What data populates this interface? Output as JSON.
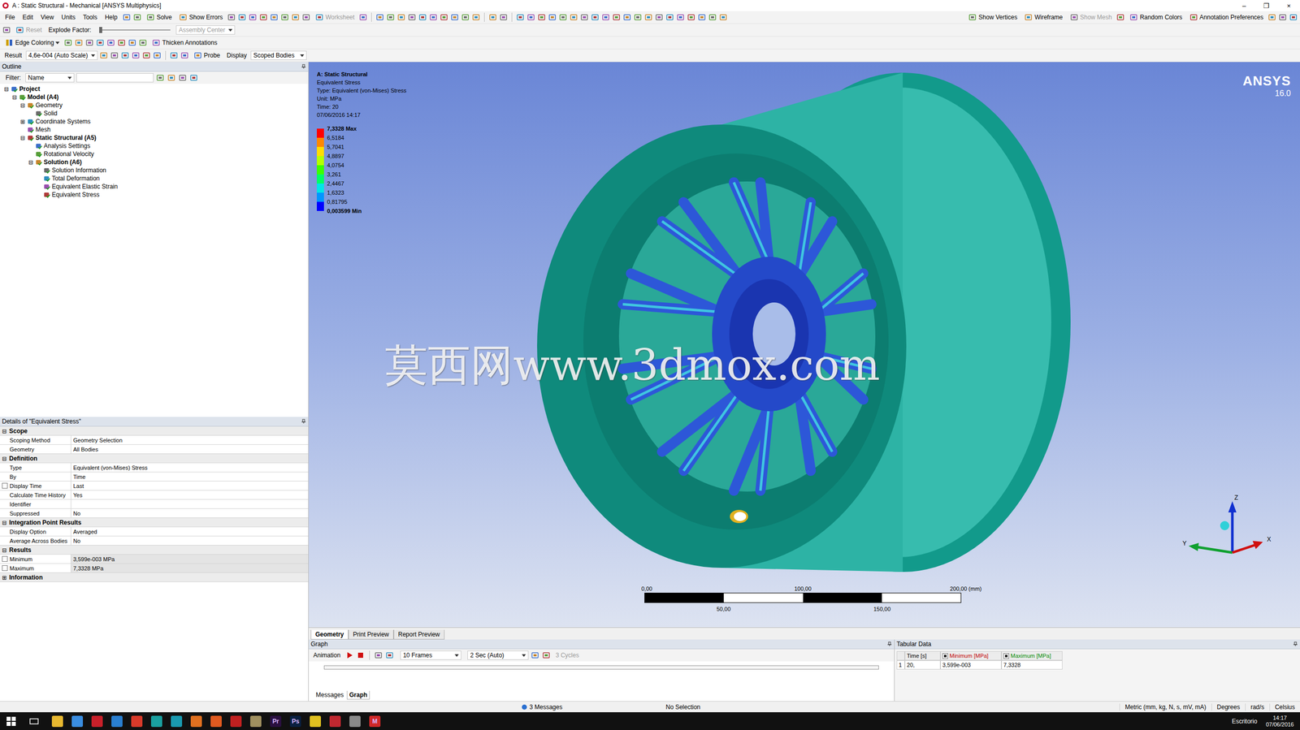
{
  "window": {
    "title": "A : Static Structural - Mechanical [ANSYS Multiphysics]",
    "controls": [
      "–",
      "❐",
      "×"
    ]
  },
  "menus": [
    "File",
    "Edit",
    "View",
    "Units",
    "Tools",
    "Help"
  ],
  "toolbar_main": [
    {
      "label": "Solve",
      "disabled": false
    },
    {
      "label": "Show Errors",
      "disabled": false
    },
    {
      "label": "Worksheet",
      "disabled": true
    }
  ],
  "toolbar_view": [
    {
      "label": "Show Vertices",
      "disabled": false
    },
    {
      "label": "Wireframe",
      "disabled": false
    },
    {
      "label": "Show Mesh",
      "disabled": true
    },
    {
      "label": "Random Colors",
      "disabled": false
    },
    {
      "label": "Annotation Preferences",
      "disabled": false
    }
  ],
  "explode_bar": {
    "reset": {
      "label": "Reset",
      "disabled": true
    },
    "factor_label": "Explode Factor:",
    "level": 0,
    "assembly": {
      "label": "Assembly Center",
      "disabled": true
    }
  },
  "edge_bar": {
    "edge_coloring": "Edge Coloring",
    "thicken": "Thicken Annotations"
  },
  "result_bar": {
    "result_label": "Result",
    "scale": "4,6e-004 (Auto Scale)",
    "probe": "Probe",
    "display_label": "Display",
    "display": "Scoped Bodies"
  },
  "outline": {
    "title": "Outline",
    "filter_label": "Filter:",
    "filter_value": "Name",
    "filter_text": "",
    "tree": [
      {
        "label": "Project",
        "depth": 0,
        "expander": "⊟",
        "bold": true
      },
      {
        "label": "Model (A4)",
        "depth": 1,
        "expander": "⊟",
        "bold": true
      },
      {
        "label": "Geometry",
        "depth": 2,
        "expander": "⊟",
        "bold": false
      },
      {
        "label": "Solid",
        "depth": 3,
        "expander": "",
        "bold": false
      },
      {
        "label": "Coordinate Systems",
        "depth": 2,
        "expander": "⊞",
        "bold": false
      },
      {
        "label": "Mesh",
        "depth": 2,
        "expander": "",
        "bold": false
      },
      {
        "label": "Static Structural (A5)",
        "depth": 2,
        "expander": "⊟",
        "bold": true
      },
      {
        "label": "Analysis Settings",
        "depth": 3,
        "expander": "",
        "bold": false
      },
      {
        "label": "Rotational Velocity",
        "depth": 3,
        "expander": "",
        "bold": false
      },
      {
        "label": "Solution (A6)",
        "depth": 3,
        "expander": "⊟",
        "bold": true
      },
      {
        "label": "Solution Information",
        "depth": 4,
        "expander": "",
        "bold": false
      },
      {
        "label": "Total Deformation",
        "depth": 4,
        "expander": "",
        "bold": false
      },
      {
        "label": "Equivalent Elastic Strain",
        "depth": 4,
        "expander": "",
        "bold": false
      },
      {
        "label": "Equivalent Stress",
        "depth": 4,
        "expander": "",
        "bold": false
      }
    ]
  },
  "details": {
    "title": "Details of \"Equivalent Stress\"",
    "sections": [
      {
        "label": "Scope",
        "expander": "⊟",
        "rows": [
          {
            "label": "Scoping Method",
            "value": "Geometry Selection",
            "checkbox": false,
            "checked": false,
            "readonly": false
          },
          {
            "label": "Geometry",
            "value": "All Bodies",
            "checkbox": false,
            "checked": false,
            "readonly": false
          }
        ]
      },
      {
        "label": "Definition",
        "expander": "⊟",
        "rows": [
          {
            "label": "Type",
            "value": "Equivalent (von-Mises) Stress",
            "checkbox": false,
            "checked": false,
            "readonly": false
          },
          {
            "label": "By",
            "value": "Time",
            "checkbox": false,
            "checked": false,
            "readonly": false
          },
          {
            "label": "Display Time",
            "value": "Last",
            "checkbox": true,
            "checked": false,
            "readonly": false
          },
          {
            "label": "Calculate Time History",
            "value": "Yes",
            "checkbox": false,
            "checked": false,
            "readonly": false
          },
          {
            "label": "Identifier",
            "value": "",
            "checkbox": false,
            "checked": false,
            "readonly": false
          },
          {
            "label": "Suppressed",
            "value": "No",
            "checkbox": false,
            "checked": false,
            "readonly": false
          }
        ]
      },
      {
        "label": "Integration Point Results",
        "expander": "⊟",
        "rows": [
          {
            "label": "Display Option",
            "value": "Averaged",
            "checkbox": false,
            "checked": false,
            "readonly": false
          },
          {
            "label": "Average Across Bodies",
            "value": "No",
            "checkbox": false,
            "checked": false,
            "readonly": false
          }
        ]
      },
      {
        "label": "Results",
        "expander": "⊟",
        "rows": [
          {
            "label": "Minimum",
            "value": "3,599e-003 MPa",
            "checkbox": true,
            "checked": false,
            "readonly": true
          },
          {
            "label": "Maximum",
            "value": "7,3328 MPa",
            "checkbox": true,
            "checked": false,
            "readonly": true
          }
        ]
      },
      {
        "label": "Information",
        "expander": "⊞",
        "rows": []
      }
    ]
  },
  "viewport": {
    "legend": {
      "title_lines": [
        "A: Static Structural",
        "Equivalent Stress",
        "Type: Equivalent (von-Mises) Stress",
        "Unit: MPa",
        "Time: 20",
        "07/06/2016 14:17"
      ],
      "labels": [
        "7,3328 Max",
        "6,5184",
        "5,7041",
        "4,8897",
        "4,0754",
        "3,261",
        "2,4467",
        "1,6323",
        "0,81795",
        "0,003599 Min"
      ],
      "bands": [
        "#ff0000",
        "#ff8800",
        "#ffdd00",
        "#b4ff00",
        "#3cff00",
        "#00ff64",
        "#00e6e6",
        "#0096ff",
        "#0000ff"
      ]
    },
    "logo": {
      "name": "ANSYS",
      "version": "16.0"
    },
    "scale_bar": {
      "top": [
        "0,00",
        "100,00",
        "200,00 (mm)"
      ],
      "bottom": [
        "50,00",
        "150,00"
      ]
    },
    "triad": {
      "z": "Z",
      "y": "Y",
      "x": "X"
    },
    "watermark": "莫西网www.3dmox.com"
  },
  "view_tabs": [
    {
      "label": "Geometry",
      "selected": true
    },
    {
      "label": "Print Preview",
      "selected": false
    },
    {
      "label": "Report Preview",
      "selected": false
    }
  ],
  "graph": {
    "title": "Graph",
    "animation_label": "Animation",
    "frames": "10 Frames",
    "duration": "2 Sec (Auto)",
    "cycles": "3 Cycles",
    "tabs": [
      {
        "label": "Messages",
        "selected": false
      },
      {
        "label": "Graph",
        "selected": true
      }
    ]
  },
  "tabular": {
    "title": "Tabular Data",
    "columns": [
      {
        "label": "Time [s]",
        "checkbox": false,
        "checked": false,
        "color": "#000000"
      },
      {
        "label": "Minimum [MPa]",
        "checkbox": true,
        "checked": true,
        "color": "#c00000"
      },
      {
        "label": "Maximum [MPa]",
        "checkbox": true,
        "checked": true,
        "color": "#008a00"
      }
    ],
    "rows": [
      {
        "index": "1",
        "cells": [
          "20,",
          "3,599e-003",
          "7,3328"
        ]
      }
    ]
  },
  "status_bar": {
    "messages": "3 Messages",
    "selection": "No Selection",
    "units": [
      "Metric (mm, kg, N, s, mV, mA)",
      "Degrees",
      "rad/s",
      "Celsius"
    ]
  },
  "taskbar": {
    "apps": [
      {
        "label": "",
        "color": "#e8b830"
      },
      {
        "label": "",
        "color": "#3a8de0"
      },
      {
        "label": "",
        "color": "#c8202a"
      },
      {
        "label": "",
        "color": "#2a7fd0"
      },
      {
        "label": "",
        "color": "#d83a2a"
      },
      {
        "label": "",
        "color": "#1aa0a0"
      },
      {
        "label": "",
        "color": "#1a9ab0"
      },
      {
        "label": "",
        "color": "#e07020"
      },
      {
        "label": "",
        "color": "#e05a20"
      },
      {
        "label": "",
        "color": "#c02020"
      },
      {
        "label": "",
        "color": "#a09060"
      },
      {
        "label": "Pr",
        "color": "#2a1040"
      },
      {
        "label": "Ps",
        "color": "#0a2040"
      },
      {
        "label": "",
        "color": "#e0c020"
      },
      {
        "label": "",
        "color": "#c02830"
      },
      {
        "label": "",
        "color": "#8a8a8a"
      },
      {
        "label": "M",
        "color": "#d02828"
      }
    ],
    "desktop": "Escritorio",
    "time": "14:17",
    "date": "07/06/2016"
  }
}
